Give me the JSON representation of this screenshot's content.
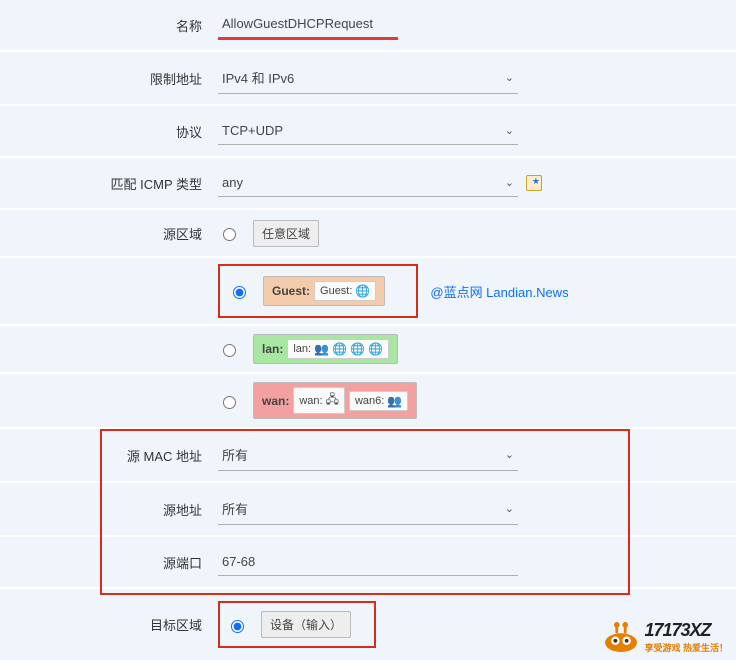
{
  "labels": {
    "name": "名称",
    "restrict_addr": "限制地址",
    "protocol": "协议",
    "icmp_type": "匹配 ICMP 类型",
    "source_zone": "源区域",
    "source_mac": "源 MAC 地址",
    "source_addr": "源地址",
    "source_port": "源端口",
    "dest_zone": "目标区域"
  },
  "values": {
    "name": "AllowGuestDHCPRequest",
    "restrict_addr": "IPv4 和 IPv6",
    "protocol": "TCP+UDP",
    "icmp_type": "any",
    "source_mac": "所有",
    "source_addr": "所有",
    "source_port": "67-68"
  },
  "zones": {
    "any": "任意区域",
    "guest": {
      "label": "Guest:",
      "inner": "Guest:"
    },
    "lan": {
      "label": "lan:",
      "inner": "lan:"
    },
    "wan": {
      "label": "wan:",
      "inner1": "wan:",
      "inner2": "wan6:"
    },
    "device": "设备（输入）"
  },
  "watermark": "@蓝点网 Landian.News",
  "watermark_logo": {
    "main": "17173XZ",
    "sub": "享受游戏 热爱生活！"
  }
}
